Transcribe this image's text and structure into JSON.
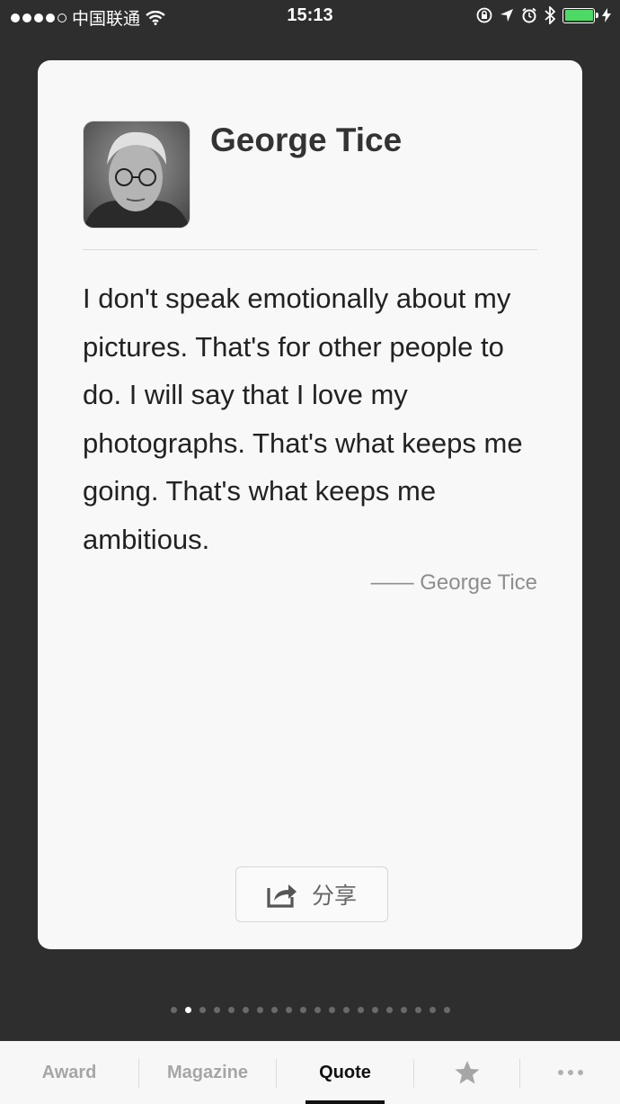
{
  "status_bar": {
    "carrier": "中国联通",
    "time": "15:13"
  },
  "card": {
    "name": "George Tice",
    "quote": "I don't speak emotionally about my pictures. That's for other people to do. I will say that I love my photographs. That's what keeps me going. That's what keeps me ambitious.",
    "attribution": "—— George Tice",
    "share_label": "分享"
  },
  "pager": {
    "total": 20,
    "current": 2
  },
  "tabs": [
    {
      "label": "Award"
    },
    {
      "label": "Magazine"
    },
    {
      "label": "Quote"
    },
    {
      "icon": "star-icon"
    },
    {
      "icon": "more-icon"
    }
  ],
  "colors": {
    "background": "#2e2e2e",
    "card": "#f8f8f8",
    "battery": "#4cd964",
    "active_tab": "#111111"
  }
}
